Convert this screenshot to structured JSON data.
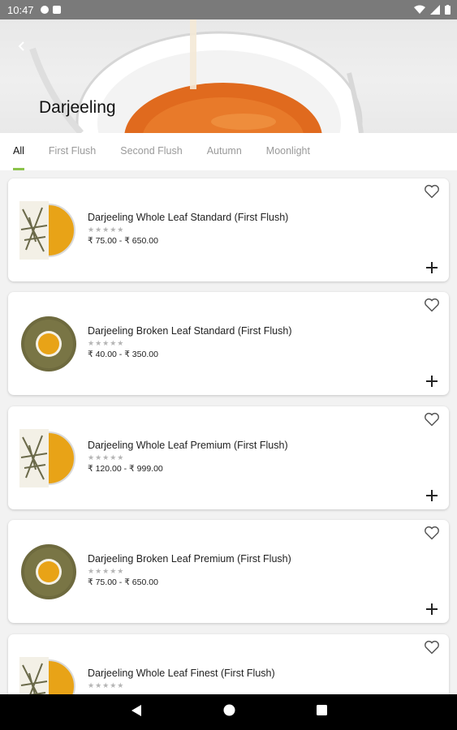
{
  "status_bar": {
    "time": "10:47"
  },
  "header": {
    "title": "Darjeeling",
    "back_icon": "chevron-left-icon"
  },
  "tabs": [
    {
      "label": "All",
      "active": true
    },
    {
      "label": "First Flush",
      "active": false
    },
    {
      "label": "Second Flush",
      "active": false
    },
    {
      "label": "Autumn",
      "active": false
    },
    {
      "label": "Moonlight",
      "active": false
    }
  ],
  "products": [
    {
      "name": "Darjeeling Whole Leaf Standard (First Flush)",
      "rating": "★★★★★",
      "price": "₹ 75.00 - ₹ 650.00",
      "image": "whole-leaf"
    },
    {
      "name": "Darjeeling Broken Leaf Standard (First Flush)",
      "rating": "★★★★★",
      "price": "₹ 40.00 - ₹ 350.00",
      "image": "broken-leaf"
    },
    {
      "name": "Darjeeling Whole Leaf Premium (First Flush)",
      "rating": "★★★★★",
      "price": "₹ 120.00 - ₹ 999.00",
      "image": "whole-leaf"
    },
    {
      "name": "Darjeeling Broken Leaf Premium (First Flush)",
      "rating": "★★★★★",
      "price": "₹ 75.00 - ₹ 650.00",
      "image": "broken-leaf"
    },
    {
      "name": "Darjeeling Whole Leaf Finest (First Flush)",
      "rating": "★★★★★",
      "price": "",
      "image": "whole-leaf"
    }
  ],
  "colors": {
    "accent": "#8bc34a",
    "tea": "#e8a317"
  }
}
